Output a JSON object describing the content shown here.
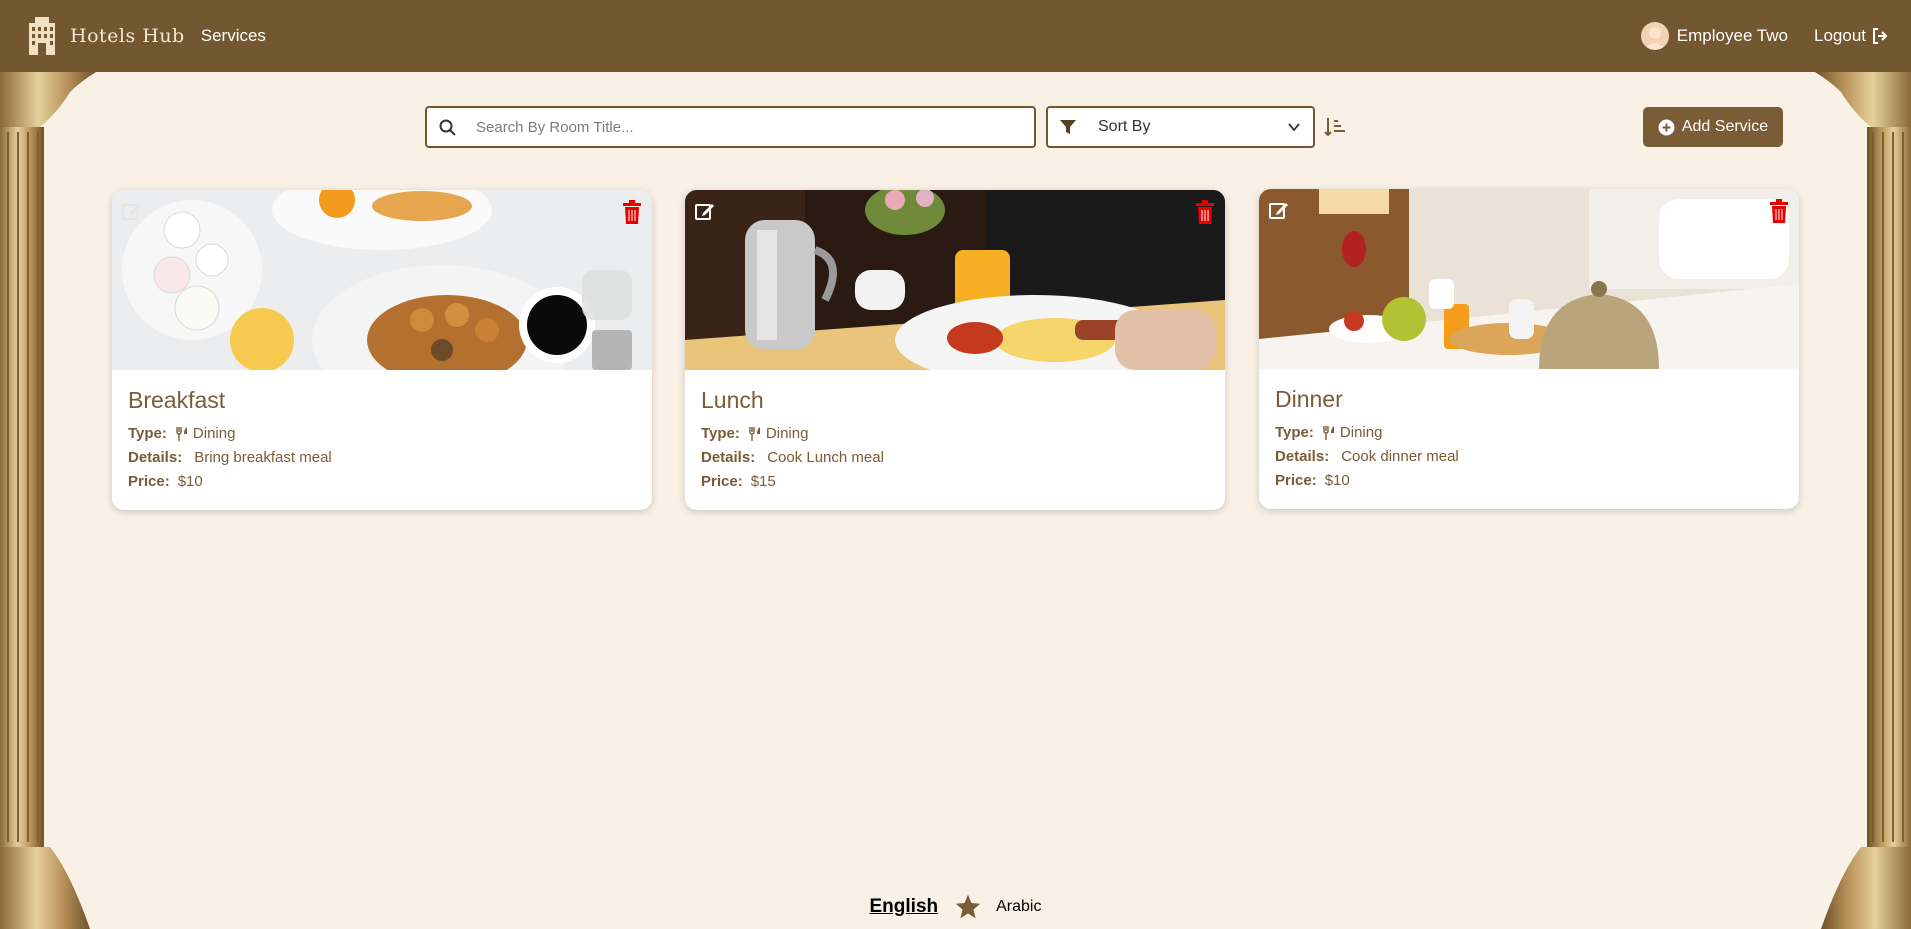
{
  "nav": {
    "brand_name": "Hotels Hub",
    "services_link": "Services",
    "user_name": "Employee Two",
    "logout_label": "Logout"
  },
  "toolbar": {
    "search_placeholder": "Search By Room Title...",
    "sort_label": "Sort By",
    "add_label": "Add Service"
  },
  "labels": {
    "type": "Type:",
    "details": "Details:",
    "price": "Price:"
  },
  "services": [
    {
      "title": "Breakfast",
      "type": "Dining",
      "details": "Bring breakfast meal",
      "price": "$10"
    },
    {
      "title": "Lunch",
      "type": "Dining",
      "details": "Cook Lunch meal",
      "price": "$15"
    },
    {
      "title": "Dinner",
      "type": "Dining",
      "details": "Cook dinner meal",
      "price": "$10"
    }
  ],
  "footer": {
    "english": "English",
    "arabic": "Arabic"
  },
  "colors": {
    "navbar": "#725730",
    "accent": "#7a5c36",
    "background": "#f9f1e6",
    "delete": "#e60000"
  }
}
